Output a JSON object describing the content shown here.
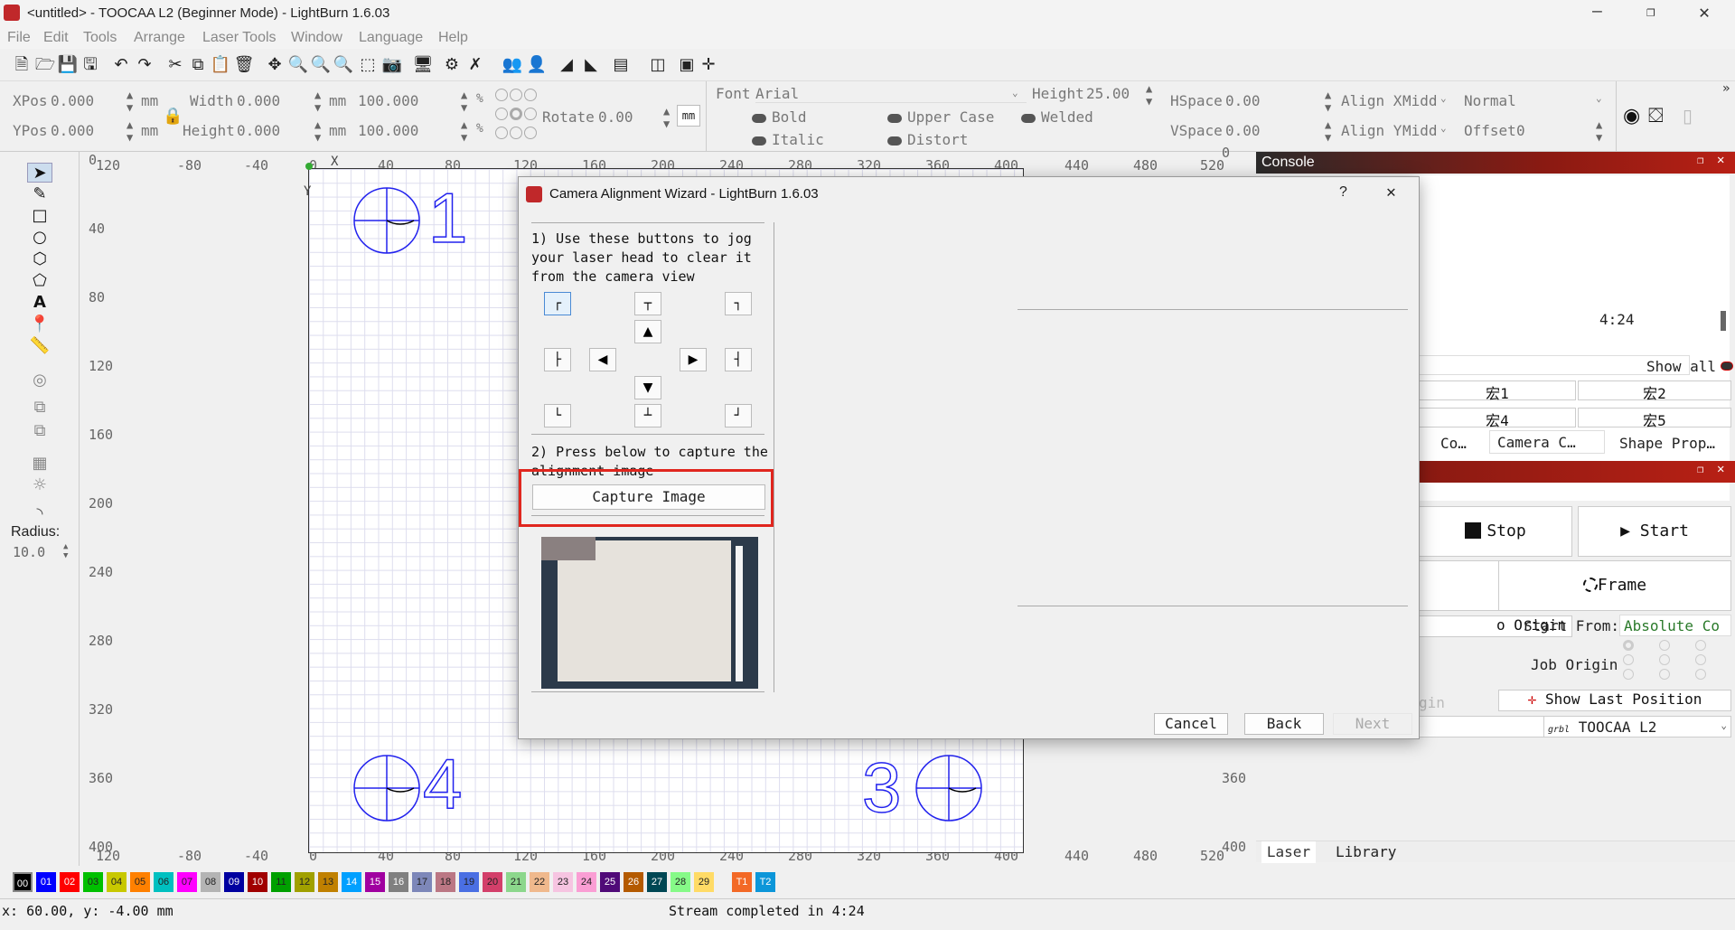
{
  "window": {
    "title": "<untitled> - TOOCAA L2 (Beginner Mode) - LightBurn 1.6.03"
  },
  "menu": [
    "File",
    "Edit",
    "Tools",
    "Arrange",
    "Laser Tools",
    "Window",
    "Language",
    "Help"
  ],
  "props": {
    "xpos_label": "XPos",
    "xpos": "0.000",
    "ypos_label": "YPos",
    "ypos": "0.000",
    "unit": "mm",
    "width_label": "Width",
    "width": "0.000",
    "height_label": "Height",
    "height": "0.000",
    "wpct": "100.000",
    "hpct": "100.000",
    "pct": "%",
    "rotate_label": "Rotate",
    "rotate": "0.00",
    "rotate_unit": "mm",
    "font_label": "Font",
    "font": "Arial",
    "fheight_label": "Height",
    "fheight": "25.00",
    "hspace_label": "HSpace",
    "hspace": "0.00",
    "vspace_label": "VSpace",
    "vspace": "0.00",
    "alignx_label": "Align X",
    "alignx": "Midd",
    "aligny_label": "Align Y",
    "aligny": "Midd",
    "style": "Normal",
    "offset_label": "Offset",
    "offset": "0",
    "bold": "Bold",
    "italic": "Italic",
    "upper": "Upper Case",
    "distort": "Distort",
    "welded": "Welded"
  },
  "tools": {
    "radius_label": "Radius:",
    "radius": "10.0"
  },
  "ruler": {
    "top": [
      "120",
      "-80",
      "-40",
      "0",
      "40",
      "80",
      "120",
      "160",
      "200",
      "240",
      "280",
      "320",
      "360",
      "400",
      "440",
      "480",
      "520"
    ],
    "left": [
      "0",
      "40",
      "80",
      "120",
      "160",
      "200",
      "240",
      "280",
      "320",
      "360",
      "400"
    ],
    "bottom": [
      "120",
      "-80",
      "-40",
      "0",
      "40",
      "80",
      "120",
      "160",
      "200",
      "240",
      "280",
      "320",
      "360",
      "400",
      "440",
      "480",
      "520"
    ],
    "right": [
      "0",
      "360",
      "400"
    ],
    "x_label": "X",
    "y_label": "Y"
  },
  "markers": [
    "1",
    "4",
    "3"
  ],
  "dialog": {
    "title": "Camera Alignment Wizard - LightBurn 1.6.03",
    "help": "?",
    "step1": "1) Use these buttons to jog your laser head to clear it from the camera view",
    "step2": "2) Press below to capture the alignment image",
    "capture": "Capture Image",
    "cancel": "Cancel",
    "back": "Back",
    "next": "Next"
  },
  "console": {
    "title": "Console",
    "line": "4:24",
    "show_all": "Show all",
    "macros": [
      "宏1",
      "宏2",
      "宏4",
      "宏5"
    ],
    "tabs": [
      "Co…",
      "Camera C…",
      "Shape Prop…"
    ]
  },
  "laser": {
    "stop": "Stop",
    "start": "Start",
    "frame": "Frame",
    "origin_btn": "o Origin",
    "start_from_label": "Start From:",
    "start_from": "Absolute Co",
    "job_origin_label": "Job Origin",
    "gin": "gin",
    "show_last": "Show Last Position",
    "device_prefix": "grbl",
    "device": "TOOCAA L2",
    "tabs": [
      "Laser",
      "Library"
    ]
  },
  "palette": [
    {
      "l": "00",
      "c": "#000000"
    },
    {
      "l": "01",
      "c": "#0000ff"
    },
    {
      "l": "02",
      "c": "#ff0000"
    },
    {
      "l": "03",
      "c": "#00c000"
    },
    {
      "l": "04",
      "c": "#c8c800"
    },
    {
      "l": "05",
      "c": "#ff8000"
    },
    {
      "l": "06",
      "c": "#00c0c0"
    },
    {
      "l": "07",
      "c": "#ff00ff"
    },
    {
      "l": "08",
      "c": "#b4b4b4"
    },
    {
      "l": "09",
      "c": "#0000a0"
    },
    {
      "l": "10",
      "c": "#a00000"
    },
    {
      "l": "11",
      "c": "#00a000"
    },
    {
      "l": "12",
      "c": "#a0a000"
    },
    {
      "l": "13",
      "c": "#c08000"
    },
    {
      "l": "14",
      "c": "#00a0ff"
    },
    {
      "l": "15",
      "c": "#a000a0"
    },
    {
      "l": "16",
      "c": "#808080"
    },
    {
      "l": "17",
      "c": "#7d87b9"
    },
    {
      "l": "18",
      "c": "#bb7784"
    },
    {
      "l": "19",
      "c": "#4a6fe3"
    },
    {
      "l": "20",
      "c": "#d33f6a"
    },
    {
      "l": "21",
      "c": "#8cd78c"
    },
    {
      "l": "22",
      "c": "#f0b98d"
    },
    {
      "l": "23",
      "c": "#f6c4e1"
    },
    {
      "l": "24",
      "c": "#fa9ed4"
    },
    {
      "l": "25",
      "c": "#500a78"
    },
    {
      "l": "26",
      "c": "#b45a00"
    },
    {
      "l": "27",
      "c": "#004754"
    },
    {
      "l": "28",
      "c": "#86fa88"
    },
    {
      "l": "29",
      "c": "#ffdb66"
    },
    {
      "l": "T1",
      "c": "#f36926"
    },
    {
      "l": "T2",
      "c": "#0c96d9"
    }
  ],
  "status": {
    "coords": "x: 60.00, y: -4.00 mm",
    "message": "Stream completed in 4:24"
  }
}
